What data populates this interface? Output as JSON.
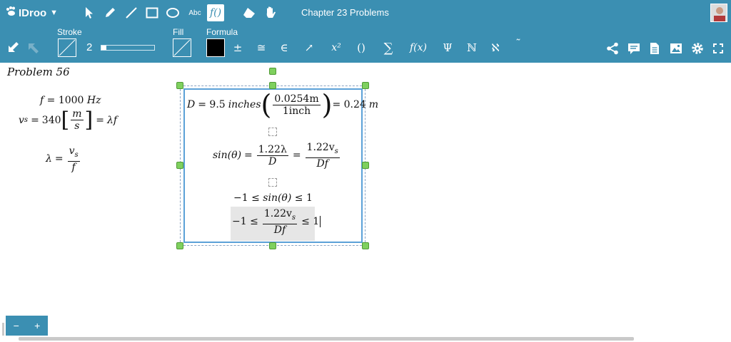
{
  "app": {
    "logo_text": "IDroo",
    "title": "Chapter 23 Problems"
  },
  "toolbar_top": {
    "text_tool_label": "Abc",
    "formula_tool_label": "f()"
  },
  "toolbar_props": {
    "stroke_label": "Stroke",
    "stroke_width": "2",
    "stroke_slider_fraction": 0.1,
    "fill_label": "Fill",
    "formula_label": "Formula",
    "formula_color": "#000000",
    "symbols": [
      "±",
      "≅",
      "∈",
      "↗",
      "x²",
      "()",
      "∑",
      "f(x)",
      "Ψ",
      "ℕ",
      "ℵ",
      "˜"
    ]
  },
  "canvas": {
    "problem_title": "Problem 56",
    "left_equations": {
      "f_line": {
        "lhs": "f",
        "eq": "=",
        "value": "1000",
        "unit": "Hz"
      },
      "vs_line": {
        "lhs": "v",
        "sub": "s",
        "eq": "=",
        "value": "340",
        "unit_num": "m",
        "unit_den": "s",
        "eq2": "=",
        "rhs": "λf"
      },
      "lambda_line": {
        "lhs": "λ",
        "eq": "=",
        "num": "v",
        "num_sub": "s",
        "den": "f"
      }
    },
    "formula_box": {
      "line1": {
        "lhs": "D",
        "eq": "= 9.5",
        "word": "inches",
        "num": "0.0254m",
        "den": "1inch",
        "result": "= 0.24",
        "unit": "m"
      },
      "line2": {
        "lhs": "sin(θ)",
        "eq": "=",
        "num1": "1.22λ",
        "den1": "D",
        "eq2": "=",
        "num2": "1.22v",
        "num2_sub": "s",
        "den2": "Df"
      },
      "line3": {
        "left": "−1 ≤",
        "mid": "sin(θ)",
        "right": "≤ 1"
      },
      "line4": {
        "left": "−1 ≤",
        "num": "1.22v",
        "num_sub": "s",
        "den": "Df",
        "right": "≤ 1"
      }
    }
  },
  "zoom": {
    "minus": "−",
    "plus": "+"
  },
  "colors": {
    "toolbar": "#3b8fb2",
    "selection": "#5ba1d8",
    "handle": "#7fd05e"
  }
}
